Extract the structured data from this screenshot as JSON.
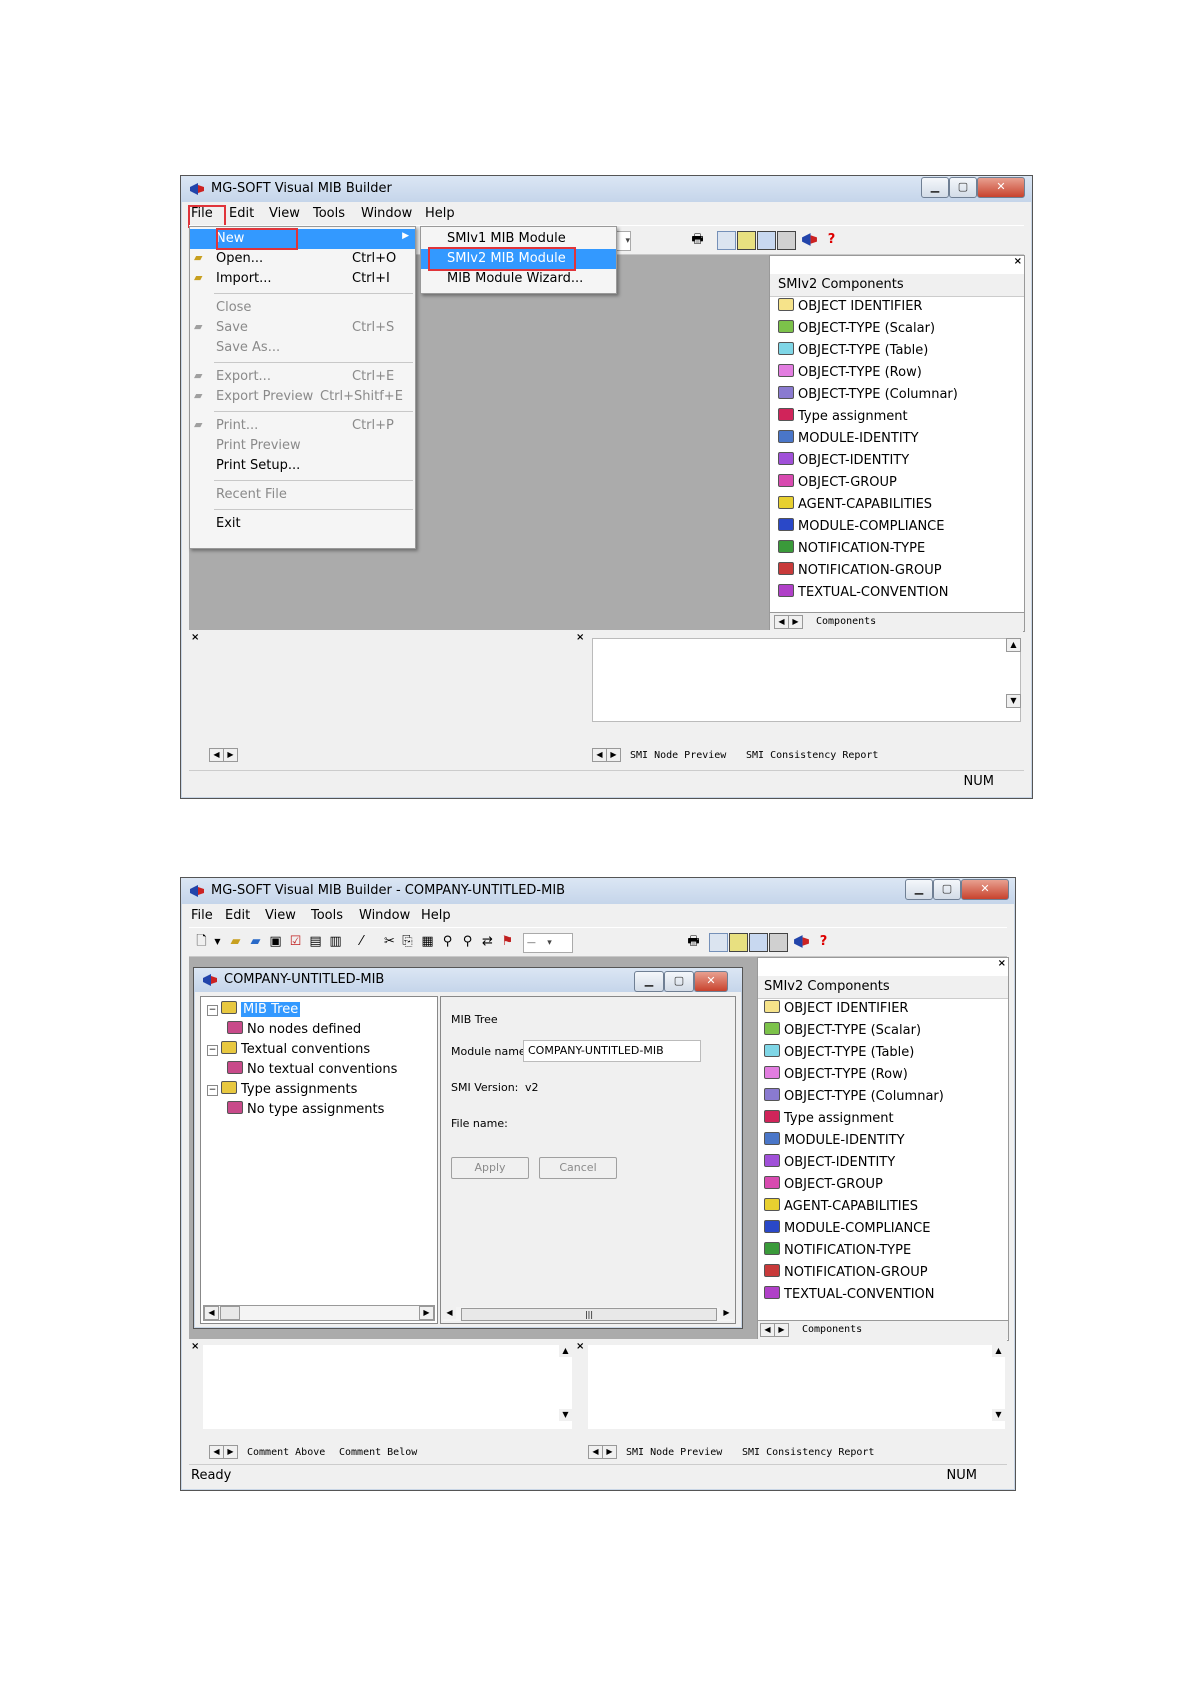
{
  "colors": {
    "menu_highlight": "#3399ff",
    "callout_red": "#e0343a",
    "mdi_grey": "#ababab"
  },
  "win1": {
    "title": "MG-SOFT Visual MIB Builder",
    "menus": [
      "File",
      "Edit",
      "View",
      "Tools",
      "Window",
      "Help"
    ],
    "file_menu": [
      {
        "label": "New",
        "shortcut": "",
        "state": "highlight",
        "icon": "none"
      },
      {
        "label": "Open...",
        "shortcut": "Ctrl+O",
        "state": "enabled",
        "icon": "open-folder-icon"
      },
      {
        "label": "Import...",
        "shortcut": "Ctrl+I",
        "state": "enabled",
        "icon": "import-icon"
      },
      {
        "label": "Close",
        "shortcut": "",
        "state": "disabled",
        "icon": "none"
      },
      {
        "label": "Save",
        "shortcut": "Ctrl+S",
        "state": "disabled",
        "icon": "floppy-icon"
      },
      {
        "label": "Save As...",
        "shortcut": "",
        "state": "disabled",
        "icon": "none"
      },
      {
        "label": "Export...",
        "shortcut": "Ctrl+E",
        "state": "disabled",
        "icon": "export-icon"
      },
      {
        "label": "Export Preview",
        "shortcut": "Ctrl+Shitf+E",
        "state": "disabled",
        "icon": "preview-icon"
      },
      {
        "label": "Print...",
        "shortcut": "Ctrl+P",
        "state": "disabled",
        "icon": "printer-icon"
      },
      {
        "label": "Print Preview",
        "shortcut": "",
        "state": "disabled",
        "icon": "none"
      },
      {
        "label": "Print Setup...",
        "shortcut": "",
        "state": "enabled",
        "icon": "none"
      },
      {
        "label": "Recent File",
        "shortcut": "",
        "state": "disabled",
        "icon": "none"
      },
      {
        "label": "Exit",
        "shortcut": "",
        "state": "enabled",
        "icon": "none"
      }
    ],
    "new_submenu": [
      "SMIv1 MIB Module",
      "SMIv2 MIB Module",
      "MIB Module Wizard..."
    ],
    "components_header": "SMIv2 Components",
    "components_tab": "Components",
    "bottom_tabs": [
      "SMI Node Preview",
      "SMI Consistency Report"
    ],
    "status_right": "NUM"
  },
  "win2": {
    "title": "MG-SOFT Visual MIB Builder - COMPANY-UNTITLED-MIB",
    "menus": [
      "File",
      "Edit",
      "View",
      "Tools",
      "Window",
      "Help"
    ],
    "child_title": "COMPANY-UNTITLED-MIB",
    "tree": [
      {
        "label": "MIB Tree",
        "level": 0,
        "selected": true
      },
      {
        "label": "No nodes defined",
        "level": 1
      },
      {
        "label": "Textual conventions",
        "level": 0
      },
      {
        "label": "No textual conventions",
        "level": 1
      },
      {
        "label": "Type assignments",
        "level": 0
      },
      {
        "label": "No type assignments",
        "level": 1
      }
    ],
    "detail_heading": "MIB Tree",
    "module_name_label": "Module name:",
    "module_name_value": "COMPANY-UNTITLED-MIB",
    "smi_version_label": "SMI Version:",
    "smi_version_value": "v2",
    "file_name_label": "File name:",
    "apply": "Apply",
    "cancel": "Cancel",
    "components_header": "SMIv2 Components",
    "components_tab": "Components",
    "bottom_left_tabs": [
      "Comment Above",
      "Comment Below"
    ],
    "bottom_right_tabs": [
      "SMI Node Preview",
      "SMI Consistency Report"
    ],
    "status_left": "Ready",
    "status_right": "NUM"
  },
  "components": [
    {
      "label": "OBJECT IDENTIFIER",
      "color": "#f6e38a"
    },
    {
      "label": "OBJECT-TYPE (Scalar)",
      "color": "#7cc24a"
    },
    {
      "label": "OBJECT-TYPE (Table)",
      "color": "#7fd6e6"
    },
    {
      "label": "OBJECT-TYPE (Row)",
      "color": "#e27de0"
    },
    {
      "label": "OBJECT-TYPE (Columnar)",
      "color": "#8a7ad0"
    },
    {
      "label": "Type assignment",
      "color": "#d0245a"
    },
    {
      "label": "MODULE-IDENTITY",
      "color": "#4a76c8"
    },
    {
      "label": "OBJECT-IDENTITY",
      "color": "#a050d8"
    },
    {
      "label": "OBJECT-GROUP",
      "color": "#d84ab0"
    },
    {
      "label": "AGENT-CAPABILITIES",
      "color": "#e8d030"
    },
    {
      "label": "MODULE-COMPLIANCE",
      "color": "#2a48c8"
    },
    {
      "label": "NOTIFICATION-TYPE",
      "color": "#3a9a3a"
    },
    {
      "label": "NOTIFICATION-GROUP",
      "color": "#c83a3a"
    },
    {
      "label": "TEXTUAL-CONVENTION",
      "color": "#b040c8"
    }
  ]
}
